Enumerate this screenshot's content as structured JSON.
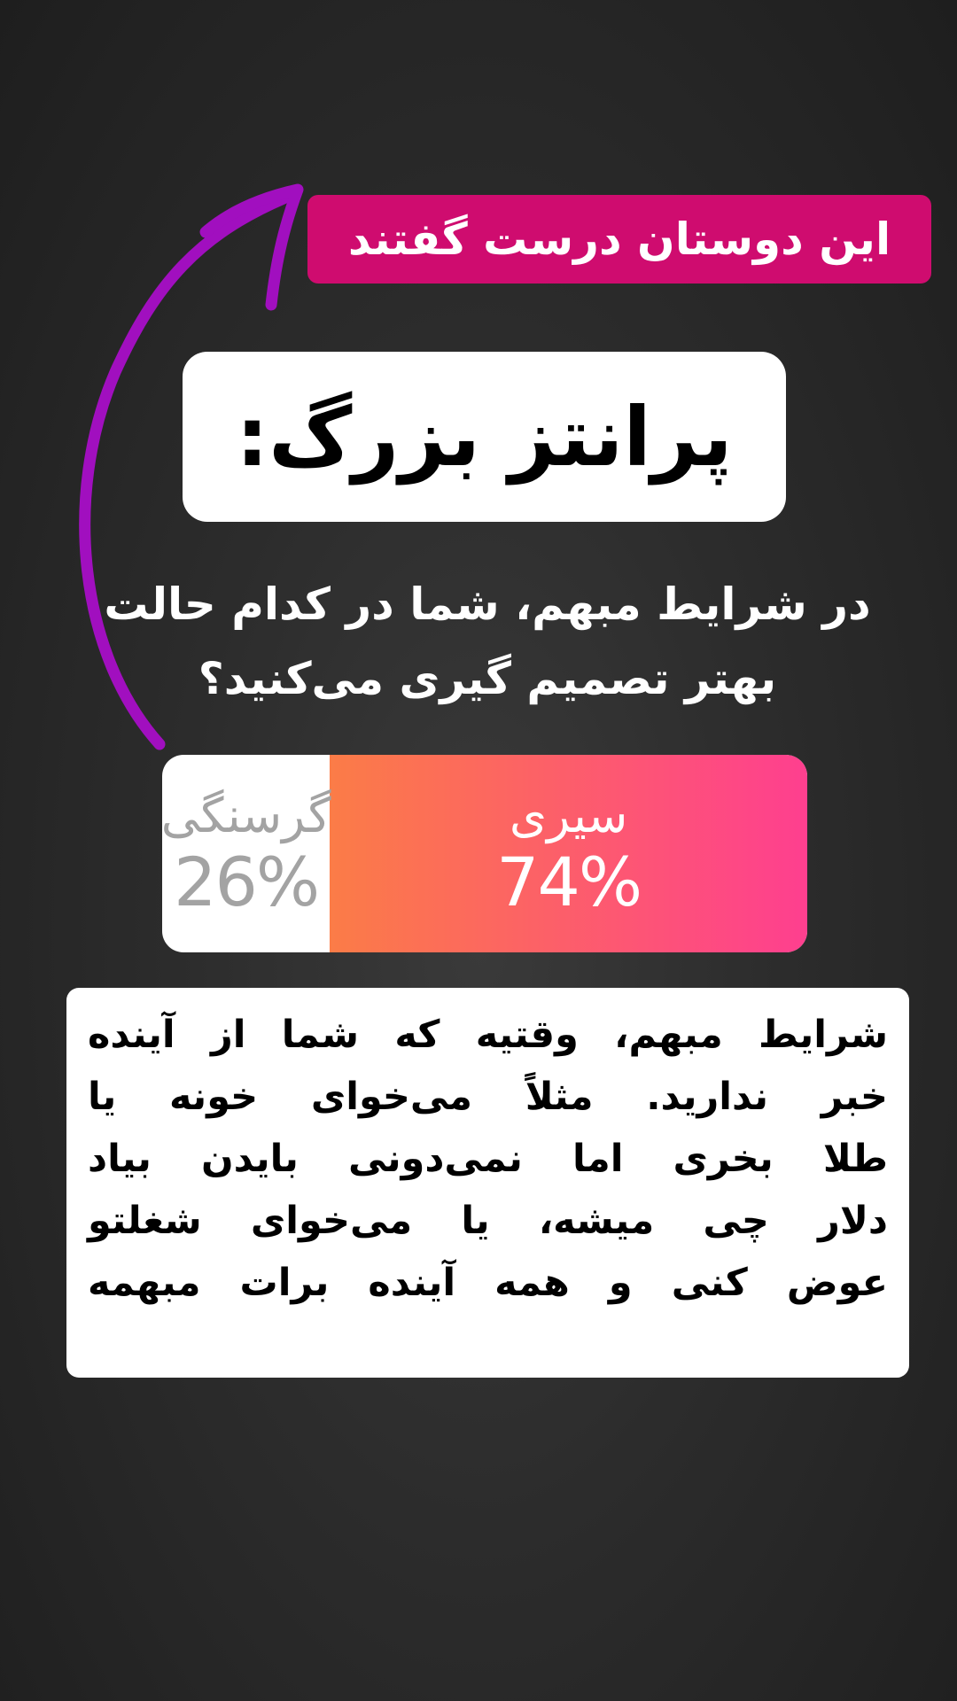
{
  "tag": {
    "text": "این دوستان درست گفتند",
    "color": "#cf0c6f"
  },
  "title": {
    "text": "پرانتز بزرگ:"
  },
  "question": {
    "line1": "در شرایط مبهم، شما در کدام حالت",
    "line2": "بهتر تصمیم گیری می‌کنید؟"
  },
  "poll": {
    "options": [
      {
        "label": "گرسنگی",
        "percent_text": "26%",
        "percent": 26
      },
      {
        "label": "سیری",
        "percent_text": "74%",
        "percent": 74
      }
    ],
    "winner_gradient": [
      "#fb7c47",
      "#fe3f8f"
    ]
  },
  "body": {
    "lines": [
      "شرایط مبهم، وقتیه که شما از آینده",
      "خبر ندارید. مثلاً می‌خوای خونه یا",
      "طلا بخری اما نمی‌دونی بایدن بیاد",
      "دلار چی میشه، یا می‌خوای شغلتو",
      "عوض کنی و همه آینده برات مبهمه"
    ]
  },
  "annotation": {
    "arrow_icon": "hand-drawn-arrow-icon",
    "arrow_color": "#a10fbf"
  }
}
